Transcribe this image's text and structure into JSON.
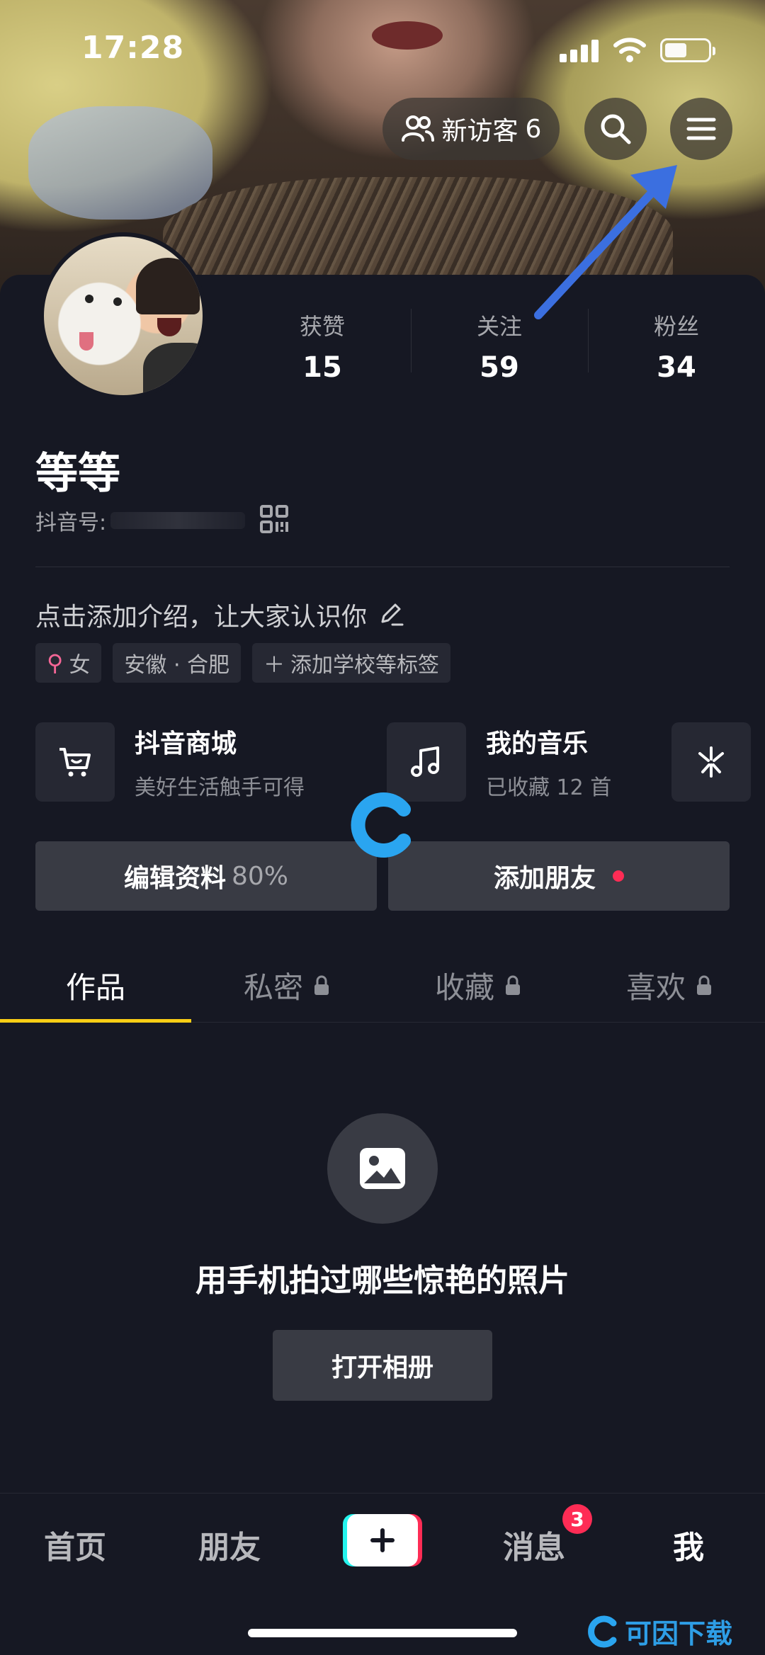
{
  "status_bar": {
    "time": "17:28"
  },
  "header": {
    "visitor_label": "新访客",
    "visitor_count": "6"
  },
  "stats": [
    {
      "label": "获赞",
      "value": "15"
    },
    {
      "label": "关注",
      "value": "59"
    },
    {
      "label": "粉丝",
      "value": "34"
    }
  ],
  "profile": {
    "nickname": "等等",
    "id_label": "抖音号:",
    "bio_placeholder": "点击添加介绍，让大家认识你",
    "tags": [
      "女",
      "安徽 · 合肥",
      "添加学校等标签"
    ]
  },
  "shortcuts": [
    {
      "title": "抖音商城",
      "subtitle": "美好生活触手可得"
    },
    {
      "title": "我的音乐",
      "subtitle": "已收藏 12 首"
    }
  ],
  "actions": {
    "edit_profile": "编辑资料",
    "edit_percent": "80%",
    "add_friends": "添加朋友"
  },
  "tabs": [
    "作品",
    "私密",
    "收藏",
    "喜欢"
  ],
  "empty_state": {
    "text": "用手机拍过哪些惊艳的照片",
    "button": "打开相册"
  },
  "bottom_nav": {
    "home": "首页",
    "friends": "朋友",
    "messages": "消息",
    "messages_badge": "3",
    "me": "我"
  },
  "watermark": {
    "text": "可因下载"
  },
  "colors": {
    "background": "#161823",
    "accent_tab": "#face15",
    "badge": "#fe2c55",
    "arrow": "#3b6fe0"
  }
}
